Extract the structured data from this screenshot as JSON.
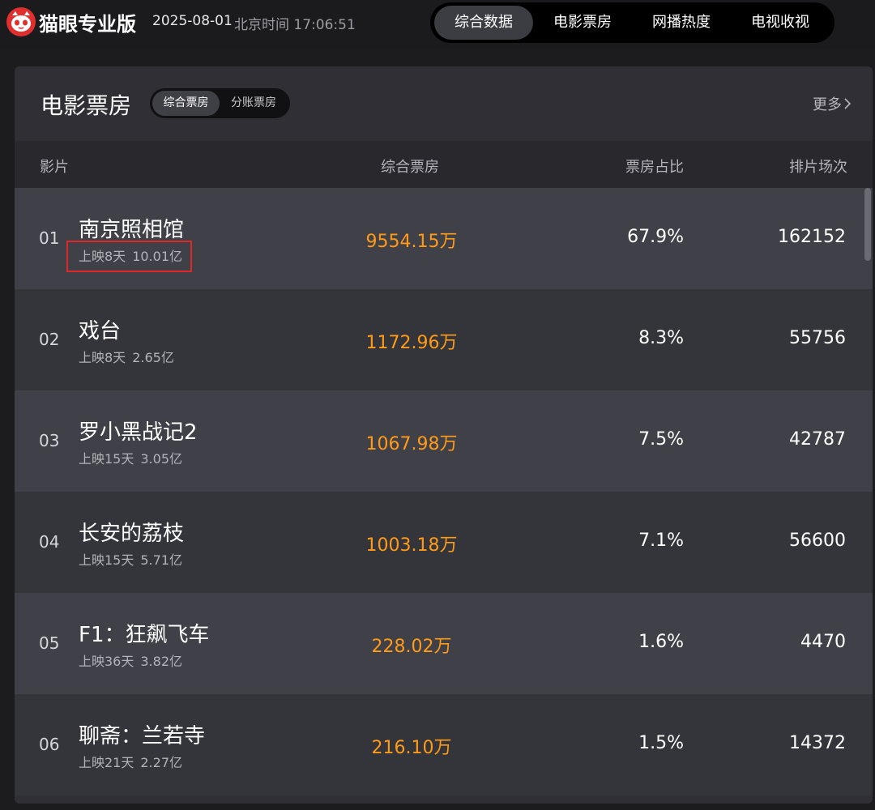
{
  "header": {
    "brand": "猫眼专业版",
    "date": "2025-08-01",
    "clock": "北京时间 17:06:51",
    "nav": [
      {
        "label": "综合数据",
        "active": true
      },
      {
        "label": "电影票房",
        "active": false
      },
      {
        "label": "网播热度",
        "active": false
      },
      {
        "label": "电视收视",
        "active": false
      }
    ]
  },
  "card": {
    "title": "电影票房",
    "segments": [
      {
        "label": "综合票房",
        "active": true
      },
      {
        "label": "分账票房",
        "active": false
      }
    ],
    "more_label": "更多",
    "columns": {
      "film": "影片",
      "gross": "综合票房",
      "share": "票房占比",
      "shows": "排片场次"
    },
    "rows": [
      {
        "rank": "01",
        "title": "南京照相馆",
        "days": "上映8天",
        "total": "10.01亿",
        "gross": "9554.15万",
        "share": "67.9%",
        "shows": "162152"
      },
      {
        "rank": "02",
        "title": "戏台",
        "days": "上映8天",
        "total": "2.65亿",
        "gross": "1172.96万",
        "share": "8.3%",
        "shows": "55756"
      },
      {
        "rank": "03",
        "title": "罗小黑战记2",
        "days": "上映15天",
        "total": "3.05亿",
        "gross": "1067.98万",
        "share": "7.5%",
        "shows": "42787"
      },
      {
        "rank": "04",
        "title": "长安的荔枝",
        "days": "上映15天",
        "total": "5.71亿",
        "gross": "1003.18万",
        "share": "7.1%",
        "shows": "56600"
      },
      {
        "rank": "05",
        "title": "F1：狂飙飞车",
        "days": "上映36天",
        "total": "3.82亿",
        "gross": "228.02万",
        "share": "1.6%",
        "shows": "4470"
      },
      {
        "rank": "06",
        "title": "聊斋：兰若寺",
        "days": "上映21天",
        "total": "2.27亿",
        "gross": "216.10万",
        "share": "1.5%",
        "shows": "14372"
      }
    ]
  },
  "colors": {
    "accent": "#ff9b17",
    "brand_red": "#e02f2f",
    "highlight_box": "#e02828"
  },
  "icons": [
    "cat-logo-icon",
    "chevron-right-icon"
  ]
}
